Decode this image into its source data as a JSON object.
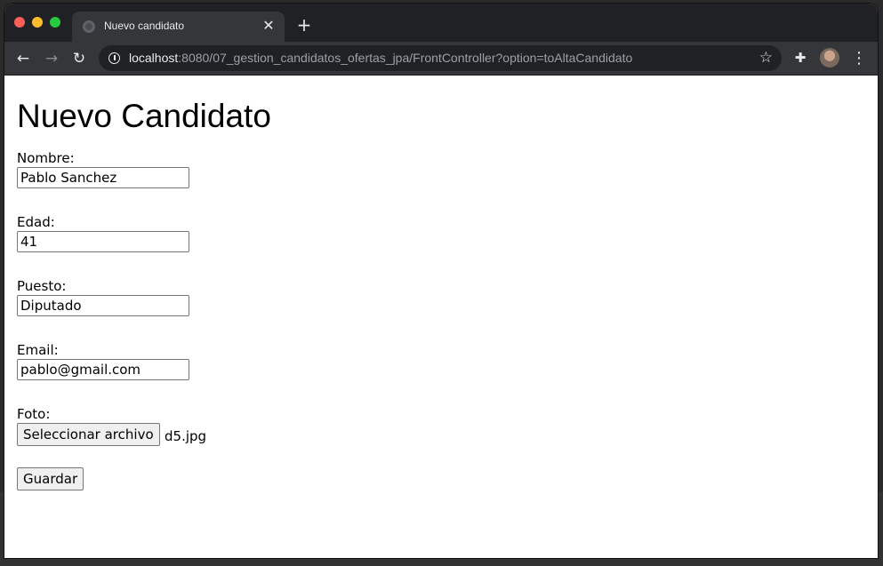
{
  "browser": {
    "tab_title": "Nuevo candidato",
    "tab_close": "✕",
    "new_tab": "+",
    "url_host": "localhost",
    "url_rest": ":8080/07_gestion_candidatos_ofertas_jpa/FrontController?option=toAltaCandidato",
    "icons": [
      "back-icon",
      "forward-icon",
      "reload-icon",
      "info-icon",
      "star-icon",
      "extensions-icon",
      "avatar",
      "menu-icon"
    ]
  },
  "page": {
    "title": "Nuevo Candidato",
    "nombre_label": "Nombre:",
    "nombre_value": "Pablo Sanchez",
    "edad_label": "Edad:",
    "edad_value": "41",
    "puesto_label": "Puesto:",
    "puesto_value": "Diputado",
    "email_label": "Email:",
    "email_value": "pablo@gmail.com",
    "foto_label": "Foto:",
    "file_button_label": "Seleccionar archivo",
    "file_name": "d5.jpg",
    "save_label": "Guardar"
  }
}
